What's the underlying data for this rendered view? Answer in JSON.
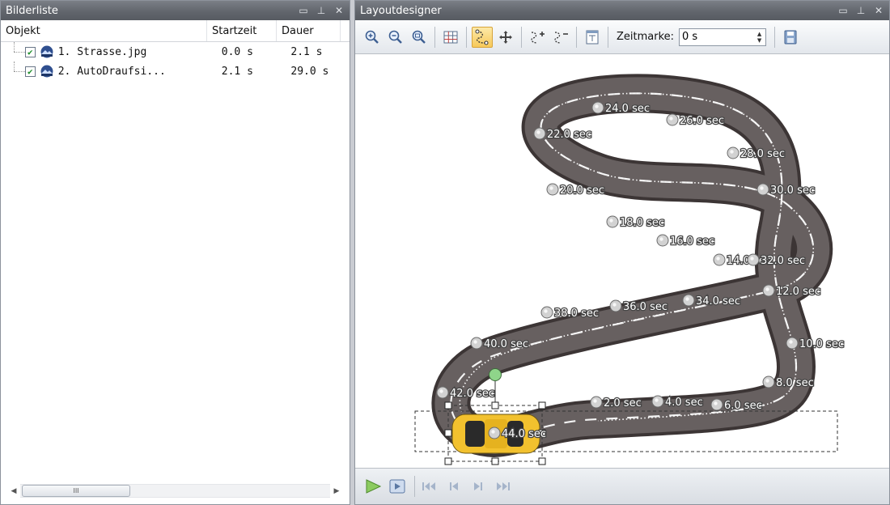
{
  "left_panel": {
    "title": "Bilderliste",
    "columns": {
      "object": "Objekt",
      "start": "Startzeit",
      "duration": "Dauer"
    },
    "rows": [
      {
        "name": "1. Strasse.jpg",
        "start": "0.0 s",
        "duration": "2.1 s",
        "checked": true
      },
      {
        "name": "2. AutoDraufsi...",
        "start": "2.1 s",
        "duration": "29.0 s",
        "checked": true
      }
    ],
    "scrollbar_grip": "III"
  },
  "right_panel": {
    "title": "Layoutdesigner",
    "toolbar": {
      "zeitmarke_label": "Zeitmarke:",
      "zeitmarke_value": "0 s"
    },
    "icons": {
      "zoom_in": "zoom-in-icon",
      "zoom_out": "zoom-out-icon",
      "zoom_fit": "zoom-fit-icon",
      "grid": "grid-icon",
      "path_mode": "path-mode-icon",
      "move": "move-icon",
      "add_point": "add-waypoint-icon",
      "remove_point": "remove-waypoint-icon",
      "properties": "properties-icon",
      "save": "save-icon"
    },
    "waypoints": [
      "2.0 sec",
      "4.0 sec",
      "6.0 sec",
      "8.0 sec",
      "10.0 sec",
      "12.0 sec",
      "14.0 sec",
      "16.0 sec",
      "18.0 sec",
      "20.0 sec",
      "22.0 sec",
      "24.0 sec",
      "26.0 sec",
      "28.0 sec",
      "30.0 sec",
      "32.0 sec",
      "34.0 sec",
      "36.0 sec",
      "38.0 sec",
      "40.0 sec",
      "42.0 sec",
      "44.0 sec"
    ]
  },
  "colors": {
    "title_bar": "#62666d",
    "active_tool": "#f7c95a",
    "road": "#5a5252",
    "car": "#f2c12e",
    "rotate_handle": "#8fd58a"
  }
}
